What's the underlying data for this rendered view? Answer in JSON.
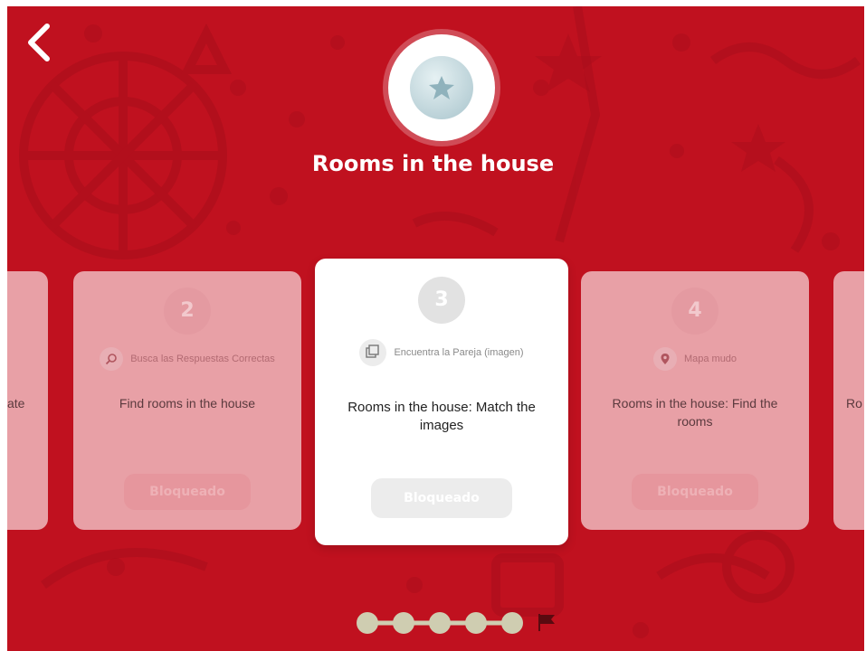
{
  "header": {
    "back_icon": "chevron-left-icon",
    "medal_icon": "star-medal-icon",
    "title": "Rooms in the house"
  },
  "cards": [
    {
      "number": "",
      "type_label": "",
      "title": "ate",
      "button_label": ""
    },
    {
      "number": "2",
      "type_icon": "search-icon",
      "type_label": "Busca las Respuestas Correctas",
      "title": "Find rooms in the house",
      "button_label": "Bloqueado"
    },
    {
      "number": "3",
      "type_icon": "cards-icon",
      "type_label": "Encuentra la Pareja (imagen)",
      "title": "Rooms in the house: Match the images",
      "button_label": "Bloqueado"
    },
    {
      "number": "4",
      "type_icon": "map-pin-icon",
      "type_label": "Mapa mudo",
      "title": "Rooms in the house: Find the rooms",
      "button_label": "Bloqueado"
    },
    {
      "number": "",
      "type_label": "",
      "title": "Ro",
      "button_label": ""
    }
  ],
  "progress": {
    "steps": 5,
    "end_icon": "flag-icon"
  },
  "colors": {
    "background": "#c0111f",
    "card": "#ffffff",
    "dot": "#cfcdb1"
  }
}
